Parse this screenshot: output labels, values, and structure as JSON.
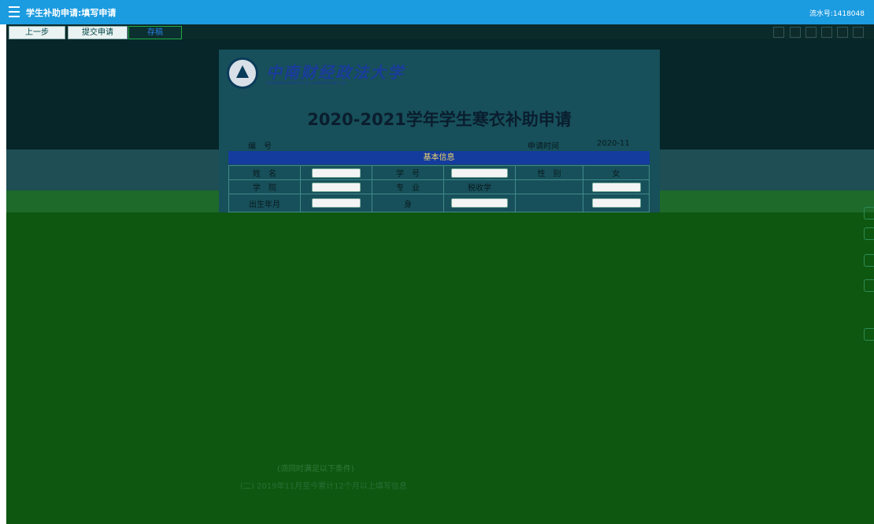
{
  "app": {
    "title": "学生补助申请:填写申请",
    "serial_number": "流水号:1418048"
  },
  "toolbar": {
    "buttons": [
      "上一步",
      "提交申请",
      "存稿"
    ],
    "icons": [
      "star-icon",
      "edit-icon",
      "save-icon",
      "print-icon",
      "cloud-upload-icon",
      "stack-icon"
    ]
  },
  "document": {
    "university_cn": "中南财经政法大学",
    "university_en": "ZHONGNAN UNIVERSITY OF ECONOMICS AND LAW",
    "title": "2020-2021学年学生寒衣补助申请",
    "number_label": "编　号",
    "date_label": "申请时间",
    "date_value": "2020-11",
    "section_basic": "基本信息",
    "rows": {
      "name_label": "姓　名",
      "student_id_label": "学　号",
      "gender_label": "性　别",
      "gender_value": "女",
      "college_label": "学　院",
      "major_label": "专　业",
      "major_value": "税收学",
      "birth_label": "出生年月",
      "id_label": "身"
    }
  },
  "ghost_text": {
    "line1": "(须同时满足以下条件)",
    "line2": "(二) 2019年11月至今累计12个月以上填写信息"
  },
  "colors": {
    "header_bg": "#1b9be0",
    "section_bar": "#143c9e",
    "overlay_green": "#0e5710"
  }
}
